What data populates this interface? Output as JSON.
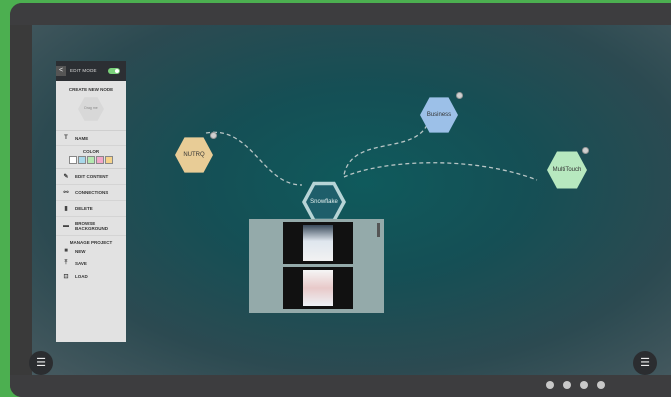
{
  "sidebar": {
    "back_label": "<",
    "mode_label": "EDIT MODE",
    "create_title": "CREATE NEW NODE",
    "preview_label": "Drag me",
    "name_label": "NAME",
    "color_label": "COLOR",
    "swatches": [
      "#ffffff",
      "#a8d8ea",
      "#b5e8b0",
      "#f3a6c8",
      "#f6d38a"
    ],
    "edit_content": "EDIT CONTENT",
    "connections": "CONNECTIONS",
    "delete": "DELETE",
    "browse_background": "BROWSE BACKGROUND",
    "manage_title": "MANAGE PROJECT",
    "new_label": "NEW",
    "save_label": "SAVE",
    "load_label": "LOAD"
  },
  "nodes": {
    "nutrq": {
      "label": "NUTRQ",
      "color": "#e8cc96"
    },
    "business": {
      "label": "Business",
      "color": "#9cc0e8"
    },
    "snowflake": {
      "label": "Snowflake",
      "color": "#1e5e6a"
    },
    "multitouch": {
      "label": "MultiTouch",
      "color": "#b7e8bf"
    }
  },
  "menu_icon": "hamburger-icon",
  "page_dots": 4
}
